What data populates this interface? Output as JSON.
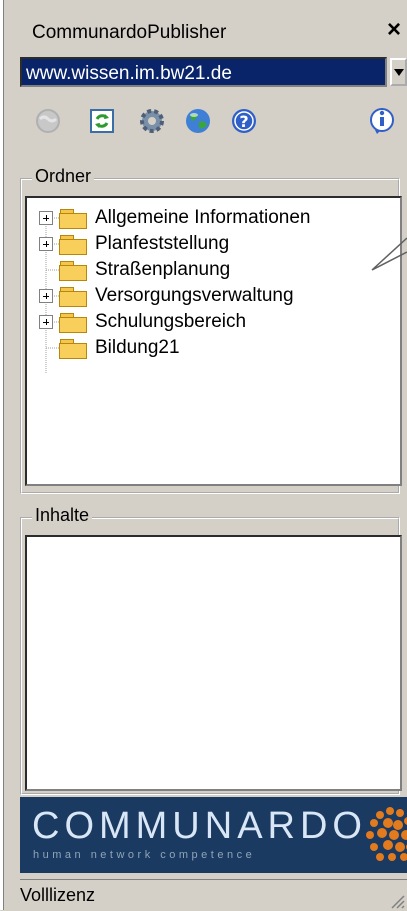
{
  "window": {
    "title": "CommunardoPublisher",
    "close_symbol": "×"
  },
  "address": {
    "value": "www.wissen.im.bw21.de"
  },
  "toolbar": {
    "icons": [
      "disabled-globe-icon",
      "refresh-icon",
      "gear-icon",
      "globe-icon",
      "help-icon",
      "info-icon"
    ]
  },
  "folders": {
    "label": "Ordner",
    "items": [
      {
        "label": "Allgemeine Informationen",
        "expandable": true
      },
      {
        "label": "Planfeststellung",
        "expandable": true
      },
      {
        "label": "Straßenplanung",
        "expandable": false
      },
      {
        "label": "Versorgungsverwaltung",
        "expandable": true
      },
      {
        "label": "Schulungsbereich",
        "expandable": true
      },
      {
        "label": "Bildung21",
        "expandable": false
      }
    ]
  },
  "contents": {
    "label": "Inhalte"
  },
  "brand": {
    "name": "COMMUNARDO",
    "tagline": "human network competence",
    "bg_color": "#1a3a61"
  },
  "statusbar": {
    "text": "Volllizenz"
  },
  "colors": {
    "selection": "#0a246a",
    "panel": "#d4d0c8"
  }
}
